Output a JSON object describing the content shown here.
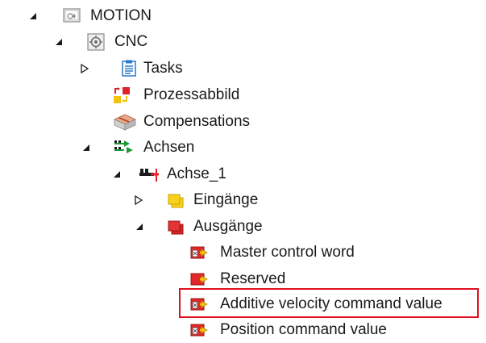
{
  "tree": {
    "motion": {
      "label": "MOTION",
      "icon": "motion-icon"
    },
    "cnc": {
      "label": "CNC",
      "icon": "cnc-icon"
    },
    "tasks": {
      "label": "Tasks",
      "icon": "tasks-icon"
    },
    "prozessabbild": {
      "label": "Prozessabbild",
      "icon": "process-image-icon"
    },
    "compensations": {
      "label": "Compensations",
      "icon": "compensations-icon"
    },
    "achsen": {
      "label": "Achsen",
      "icon": "axes-icon"
    },
    "achse1": {
      "label": "Achse_1",
      "icon": "axis-icon"
    },
    "eingaenge": {
      "label": "Eingänge",
      "icon": "inputs-icon"
    },
    "ausgaenge": {
      "label": "Ausgänge",
      "icon": "outputs-icon"
    },
    "master_control_word": {
      "label": "Master control word",
      "icon": "output-variable-icon"
    },
    "reserved": {
      "label": "Reserved",
      "icon": "output-variable-icon"
    },
    "additive_velocity": {
      "label": "Additive velocity command value",
      "icon": "output-variable-linked-icon",
      "highlighted": true
    },
    "position_command": {
      "label": "Position command value",
      "icon": "output-variable-linked-icon"
    }
  },
  "colors": {
    "highlight": "#e0101e",
    "text": "#1a1a1a"
  }
}
